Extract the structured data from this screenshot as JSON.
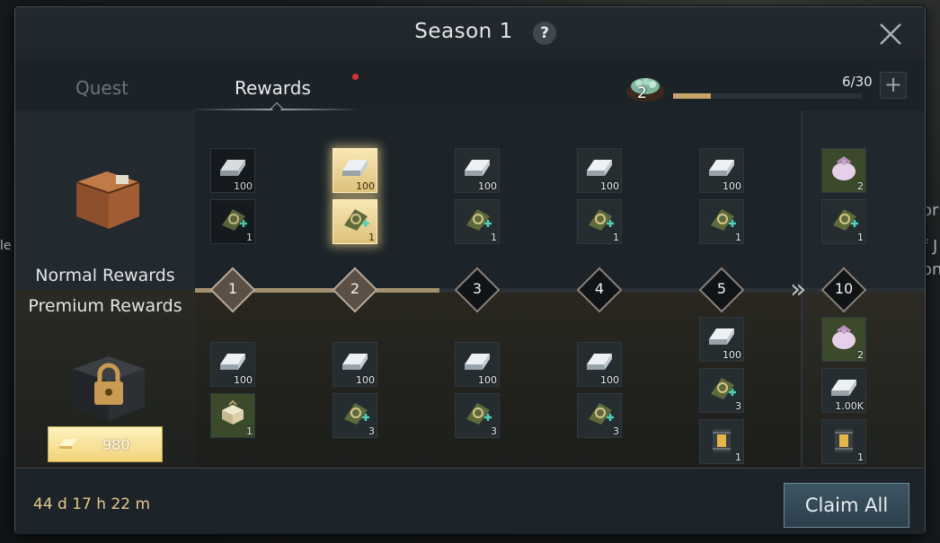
{
  "window": {
    "title": "Season 1"
  },
  "tabs": [
    {
      "label": "Quest",
      "active": false
    },
    {
      "label": "Rewards",
      "active": true
    }
  ],
  "progress": {
    "level": "2",
    "xp_text": "6/30",
    "xp_fraction": 0.2
  },
  "sidebar": {
    "normal_label": "Normal Rewards",
    "premium_label": "Premium Rewards",
    "premium_price": "980"
  },
  "levels": [
    "1",
    "2",
    "3",
    "4",
    "5",
    "10"
  ],
  "reached_levels": 2,
  "normal_rewards": [
    {
      "level": "1",
      "items": [
        {
          "icon": "silver-bar-icon",
          "qty": "100",
          "state": "claimed"
        },
        {
          "icon": "scroll-icon",
          "qty": "1",
          "state": "claimed"
        }
      ]
    },
    {
      "level": "2",
      "items": [
        {
          "icon": "silver-bar-icon",
          "qty": "100",
          "state": "claimable"
        },
        {
          "icon": "scroll-icon",
          "qty": "1",
          "state": "claimable"
        }
      ]
    },
    {
      "level": "3",
      "items": [
        {
          "icon": "silver-bar-icon",
          "qty": "100"
        },
        {
          "icon": "scroll-icon",
          "qty": "1"
        }
      ]
    },
    {
      "level": "4",
      "items": [
        {
          "icon": "silver-bar-icon",
          "qty": "100"
        },
        {
          "icon": "scroll-icon",
          "qty": "1"
        }
      ]
    },
    {
      "level": "5",
      "items": [
        {
          "icon": "silver-bar-icon",
          "qty": "100"
        },
        {
          "icon": "scroll-icon",
          "qty": "1"
        }
      ]
    },
    {
      "level": "10",
      "items": [
        {
          "icon": "pouch-icon",
          "qty": "2"
        },
        {
          "icon": "scroll-icon",
          "qty": "1"
        }
      ]
    }
  ],
  "premium_rewards": [
    {
      "level": "1",
      "items": [
        {
          "icon": "silver-bar-icon",
          "qty": "100"
        },
        {
          "icon": "gift-box-icon",
          "qty": "1"
        }
      ]
    },
    {
      "level": "2",
      "items": [
        {
          "icon": "silver-bar-icon",
          "qty": "100"
        },
        {
          "icon": "scroll-icon",
          "qty": "3"
        }
      ]
    },
    {
      "level": "3",
      "items": [
        {
          "icon": "silver-bar-icon",
          "qty": "100"
        },
        {
          "icon": "scroll-icon",
          "qty": "3"
        }
      ]
    },
    {
      "level": "4",
      "items": [
        {
          "icon": "silver-bar-icon",
          "qty": "100"
        },
        {
          "icon": "scroll-icon",
          "qty": "3"
        }
      ]
    },
    {
      "level": "5",
      "items": [
        {
          "icon": "silver-bar-icon",
          "qty": "100"
        },
        {
          "icon": "scroll-icon",
          "qty": "3"
        },
        {
          "icon": "lantern-icon",
          "qty": "1"
        }
      ]
    },
    {
      "level": "10",
      "items": [
        {
          "icon": "pouch-icon",
          "qty": "2"
        },
        {
          "icon": "silver-bar-icon",
          "qty": "1.00K"
        },
        {
          "icon": "lantern-icon",
          "qty": "1"
        }
      ]
    }
  ],
  "footer": {
    "timer": "44 d 17 h 22 m",
    "claim_all_label": "Claim All"
  },
  "colors": {
    "accent_gold": "#e5c88a",
    "track_progress": "#a39070",
    "claim_button": "#3d5564"
  }
}
